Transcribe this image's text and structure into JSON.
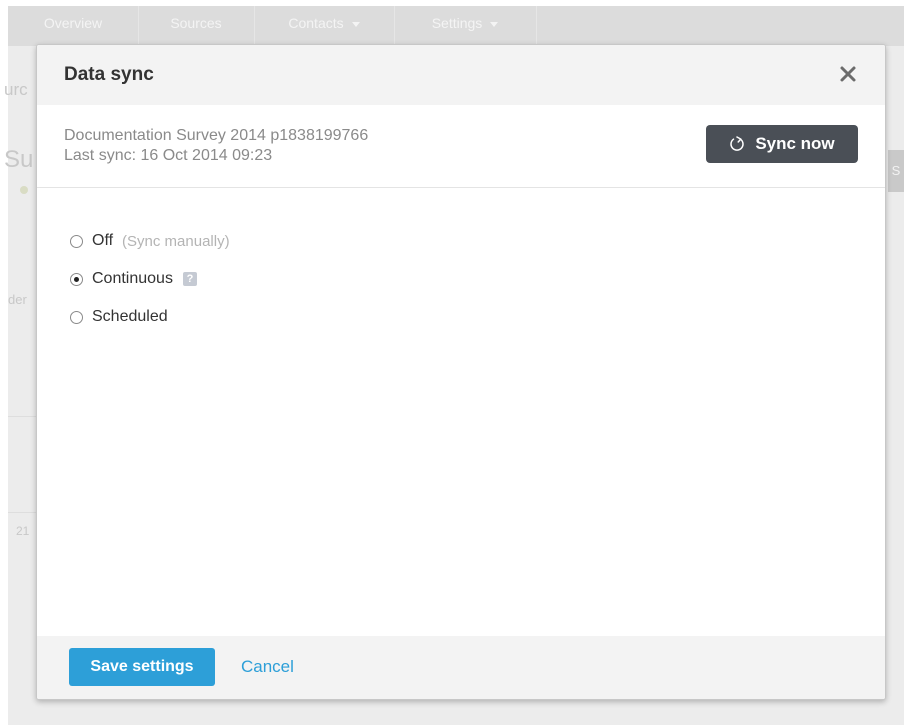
{
  "background": {
    "nav_tabs": [
      {
        "label": "Overview"
      },
      {
        "label": "Sources"
      },
      {
        "label": "Contacts"
      },
      {
        "label": "Settings"
      }
    ],
    "fragments": {
      "left_heading": "urc",
      "left_big": "Su",
      "left_small": "der",
      "left_number": "21",
      "right_tab": "S"
    }
  },
  "modal": {
    "title": "Data sync",
    "close_icon": "close-icon",
    "survey_name": "Documentation Survey 2014 p1838199766",
    "last_sync": "Last sync: 16 Oct 2014 09:23",
    "sync_button": {
      "label": "Sync now",
      "icon": "refresh-icon"
    },
    "options": [
      {
        "label": "Off",
        "hint": "(Sync manually)",
        "checked": false
      },
      {
        "label": "Continuous",
        "help_icon": "help-icon",
        "checked": true
      },
      {
        "label": "Scheduled",
        "checked": false
      }
    ],
    "footer": {
      "save_label": "Save settings",
      "cancel_label": "Cancel"
    }
  },
  "colors": {
    "accent": "#2d9fd8",
    "dark_button": "#4a4f56",
    "header_bg": "#f3f3f3"
  }
}
